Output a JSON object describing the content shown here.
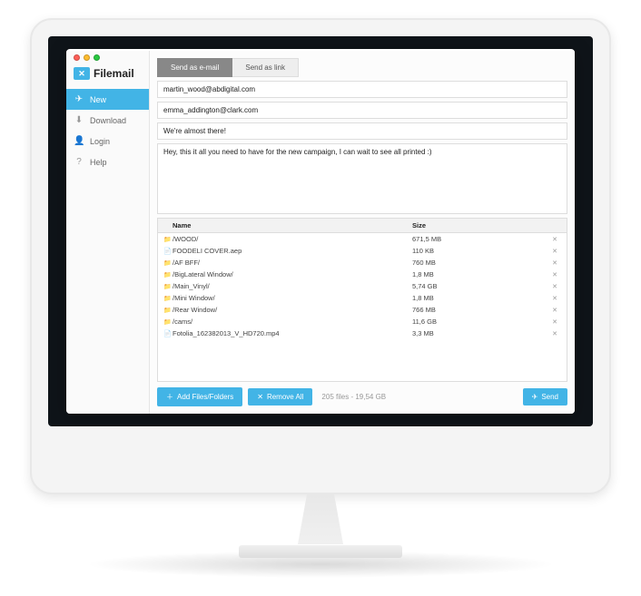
{
  "app": {
    "name": "Filemail",
    "logo_glyph": "✕"
  },
  "sidebar": {
    "items": [
      {
        "label": "New",
        "active": true,
        "icon_name": "paper-plane-icon",
        "glyph": "✈"
      },
      {
        "label": "Download",
        "active": false,
        "icon_name": "download-icon",
        "glyph": "⬇"
      },
      {
        "label": "Login",
        "active": false,
        "icon_name": "user-icon",
        "glyph": "👤"
      },
      {
        "label": "Help",
        "active": false,
        "icon_name": "help-icon",
        "glyph": "?"
      }
    ]
  },
  "tabs": [
    {
      "label": "Send as e-mail",
      "active": true
    },
    {
      "label": "Send as link",
      "active": false
    }
  ],
  "form": {
    "to": "martin_wood@abdigital.com",
    "from": "emma_addington@clark.com",
    "subject": "We're almost there!",
    "message": "Hey, this it all you need to have for the new campaign, I can wait to see all printed :)"
  },
  "file_table": {
    "headers": {
      "name": "Name",
      "size": "Size"
    },
    "rows": [
      {
        "type": "folder",
        "name": "/WOOD/",
        "size": "671,5 MB"
      },
      {
        "type": "file",
        "name": "FOODELI COVER.aep",
        "size": "110 KB"
      },
      {
        "type": "folder",
        "name": "/AF BFF/",
        "size": "760 MB"
      },
      {
        "type": "folder",
        "name": "/BigLateral Window/",
        "size": "1,8 MB"
      },
      {
        "type": "folder",
        "name": "/Main_Vinyl/",
        "size": "5,74 GB"
      },
      {
        "type": "folder",
        "name": "/Mini Window/",
        "size": "1,8 MB"
      },
      {
        "type": "folder",
        "name": "/Rear Window/",
        "size": "766 MB"
      },
      {
        "type": "folder",
        "name": "/cams/",
        "size": "11,6 GB"
      },
      {
        "type": "file",
        "name": "Fotolia_162382013_V_HD720.mp4",
        "size": "3,3 MB"
      }
    ]
  },
  "buttons": {
    "add_files": "Add Files/Folders",
    "remove_all": "Remove All",
    "send": "Send"
  },
  "summary": "205 files - 19,54 GB"
}
